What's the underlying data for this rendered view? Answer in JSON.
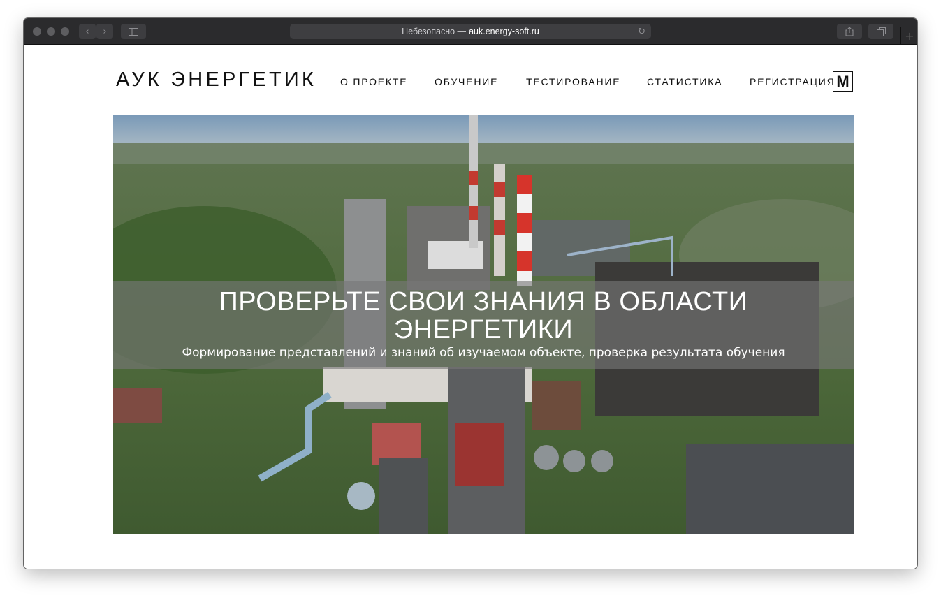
{
  "browser": {
    "url_prefix": "Небезопасно —",
    "url_host": "auk.energy-soft.ru",
    "icons": [
      "back-chevron-icon",
      "forward-chevron-icon",
      "sidebar-icon",
      "reload-icon",
      "share-icon",
      "tabs-icon",
      "new-tab-plus-icon"
    ]
  },
  "header": {
    "logo": "АУК ЭНЕРГЕТИК",
    "nav": [
      "О ПРОЕКТЕ",
      "ОБУЧЕНИЕ",
      "ТЕСТИРОВАНИЕ",
      "СТАТИСТИКА",
      "РЕГИСТРАЦИЯ"
    ],
    "badge": "M"
  },
  "hero": {
    "title_line1": "ПРОВЕРЬТЕ СВОИ ЗНАНИЯ В ОБЛАСТИ",
    "title_line2": "ЭНЕРГЕТИКИ",
    "subtitle": "Формирование представлений и знаний об изучаемом объекте, проверка результата обучения"
  },
  "colors": {
    "toolbar": "#2b2b2d",
    "accent_text": "#111111",
    "banner": "#787878"
  }
}
